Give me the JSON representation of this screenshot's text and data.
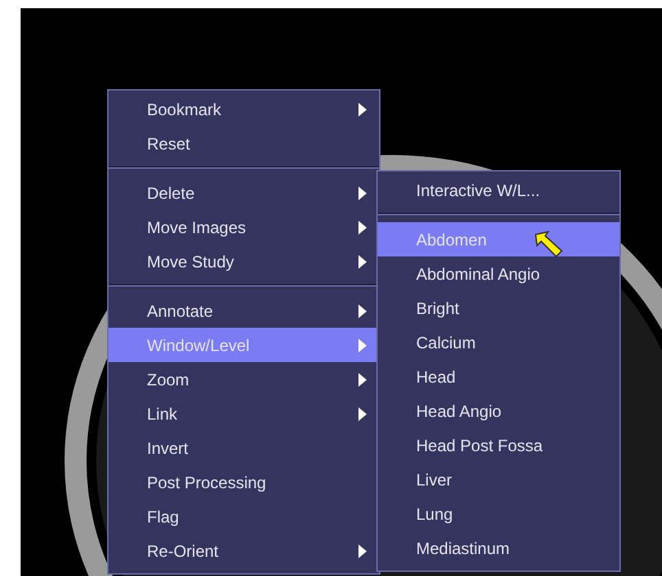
{
  "context_menu": {
    "groups": [
      [
        {
          "label": "Bookmark",
          "has_submenu": true,
          "selected": false
        },
        {
          "label": "Reset",
          "has_submenu": false,
          "selected": false
        }
      ],
      [
        {
          "label": "Delete",
          "has_submenu": true,
          "selected": false
        },
        {
          "label": "Move Images",
          "has_submenu": true,
          "selected": false
        },
        {
          "label": "Move Study",
          "has_submenu": true,
          "selected": false
        }
      ],
      [
        {
          "label": "Annotate",
          "has_submenu": true,
          "selected": false
        },
        {
          "label": "Window/Level",
          "has_submenu": true,
          "selected": true
        },
        {
          "label": "Zoom",
          "has_submenu": true,
          "selected": false
        },
        {
          "label": "Link",
          "has_submenu": true,
          "selected": false
        },
        {
          "label": "Invert",
          "has_submenu": false,
          "selected": false
        },
        {
          "label": "Post Processing",
          "has_submenu": false,
          "selected": false
        },
        {
          "label": "Flag",
          "has_submenu": false,
          "selected": false
        },
        {
          "label": "Re-Orient",
          "has_submenu": true,
          "selected": false
        }
      ]
    ]
  },
  "submenu": {
    "groups": [
      [
        {
          "label": "Interactive W/L...",
          "selected": false
        }
      ],
      [
        {
          "label": "Abdomen",
          "selected": true
        },
        {
          "label": "Abdominal Angio",
          "selected": false
        },
        {
          "label": "Bright",
          "selected": false
        },
        {
          "label": "Calcium",
          "selected": false
        },
        {
          "label": "Head",
          "selected": false
        },
        {
          "label": "Head Angio",
          "selected": false
        },
        {
          "label": "Head Post Fossa",
          "selected": false
        },
        {
          "label": "Liver",
          "selected": false
        },
        {
          "label": "Lung",
          "selected": false
        },
        {
          "label": "Mediastinum",
          "selected": false
        }
      ]
    ]
  }
}
